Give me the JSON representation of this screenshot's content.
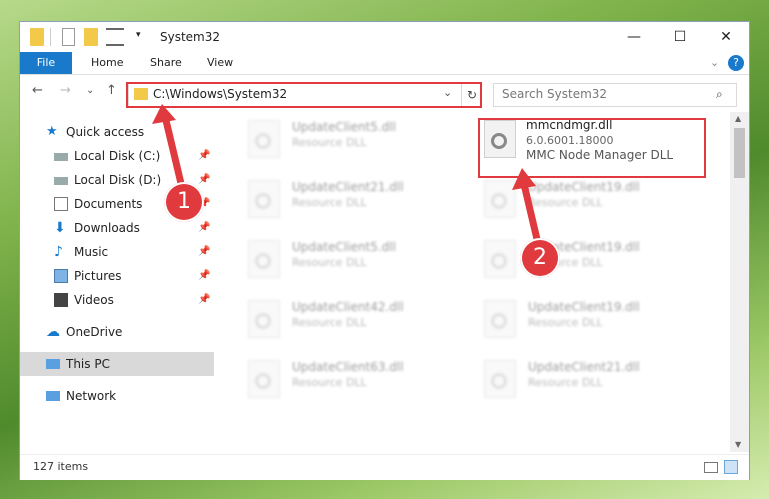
{
  "window": {
    "title": "System32"
  },
  "ribbon": {
    "file": "File",
    "home": "Home",
    "share": "Share",
    "view": "View"
  },
  "controls": {
    "minimize": "—",
    "maximize": "☐",
    "close": "✕"
  },
  "nav": {
    "back": "←",
    "forward": "→",
    "dropdown": "⌄",
    "up": "↑"
  },
  "address": {
    "path": "C:\\Windows\\System32"
  },
  "search": {
    "placeholder": "Search System32"
  },
  "sidebar": {
    "quick_access": "Quick access",
    "items": [
      {
        "label": "Local Disk (C:)"
      },
      {
        "label": "Local Disk (D:)"
      },
      {
        "label": "Documents"
      },
      {
        "label": "Downloads"
      },
      {
        "label": "Music"
      },
      {
        "label": "Pictures"
      },
      {
        "label": "Videos"
      }
    ],
    "onedrive": "OneDrive",
    "thispc": "This PC",
    "network": "Network"
  },
  "highlighted_file": {
    "name": "mmcndmgr.dll",
    "version": "6.0.6001.18000",
    "description": "MMC Node Manager DLL"
  },
  "files_col1": [
    {
      "name": "UpdateClient5.dll",
      "type": "Resource DLL"
    },
    {
      "name": "UpdateClient21.dll",
      "type": "Resource DLL"
    },
    {
      "name": "UpdateClient5.dll",
      "type": "Resource DLL"
    },
    {
      "name": "UpdateClient42.dll",
      "type": "Resource DLL"
    },
    {
      "name": "UpdateClient63.dll",
      "type": "Resource DLL"
    }
  ],
  "files_col2": [
    {
      "name": "UpdateClient19.dll",
      "type": "Resource DLL"
    },
    {
      "name": "UpdateClient19.dll",
      "type": "Resource DLL"
    },
    {
      "name": "UpdateClient19.dll",
      "type": "Resource DLL"
    },
    {
      "name": "UpdateClient21.dll",
      "type": "Resource DLL"
    }
  ],
  "status": {
    "count": "127 items"
  },
  "annotations": {
    "step1": "1",
    "step2": "2"
  },
  "colors": {
    "accent": "#1979ca",
    "annotation": "#e0393e"
  }
}
